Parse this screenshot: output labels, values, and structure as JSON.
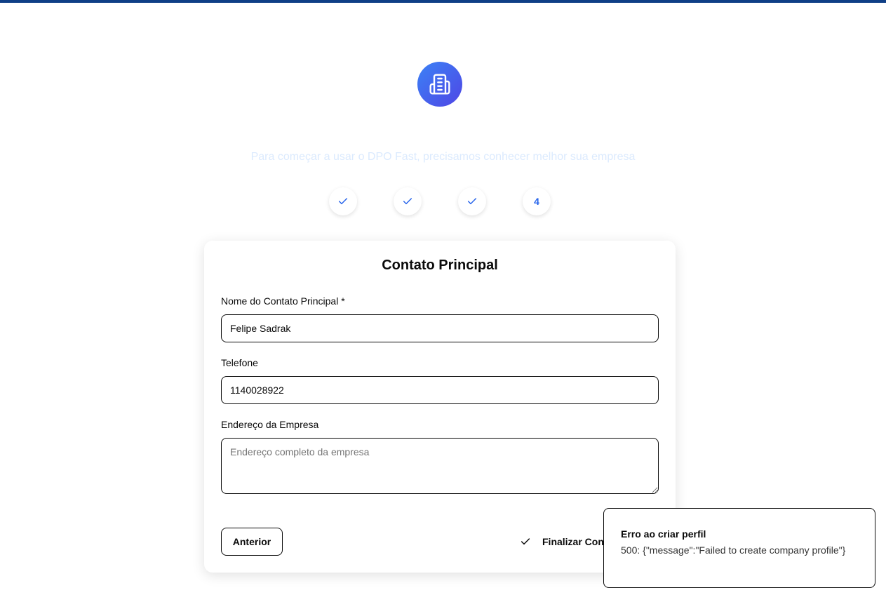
{
  "header": {
    "logo_icon": "building-icon",
    "subtitle": "Para começar a usar o DPO Fast, precisamos conhecer melhor sua empresa"
  },
  "steps": [
    {
      "state": "done",
      "label": "",
      "icon": "check-icon"
    },
    {
      "state": "done",
      "label": "",
      "icon": "check-icon"
    },
    {
      "state": "done",
      "label": "",
      "icon": "check-icon"
    },
    {
      "state": "current",
      "label": "4"
    }
  ],
  "form": {
    "title": "Contato Principal",
    "contact_name": {
      "label": "Nome do Contato Principal *",
      "value": "Felipe Sadrak"
    },
    "phone": {
      "label": "Telefone",
      "value": "1140028922"
    },
    "address": {
      "label": "Endereço da Empresa",
      "placeholder": "Endereço completo da empresa",
      "value": ""
    },
    "prev_label": "Anterior",
    "finish_label": "Finalizar Configuração"
  },
  "toast": {
    "title": "Erro ao criar perfil",
    "description": "500: {\"message\":\"Failed to create company profile\"}"
  },
  "colors": {
    "top_bar": "#0f3f86",
    "accent": "#2563eb",
    "logo_gradient_start": "#3b82f6",
    "logo_gradient_end": "#4f46e5"
  }
}
